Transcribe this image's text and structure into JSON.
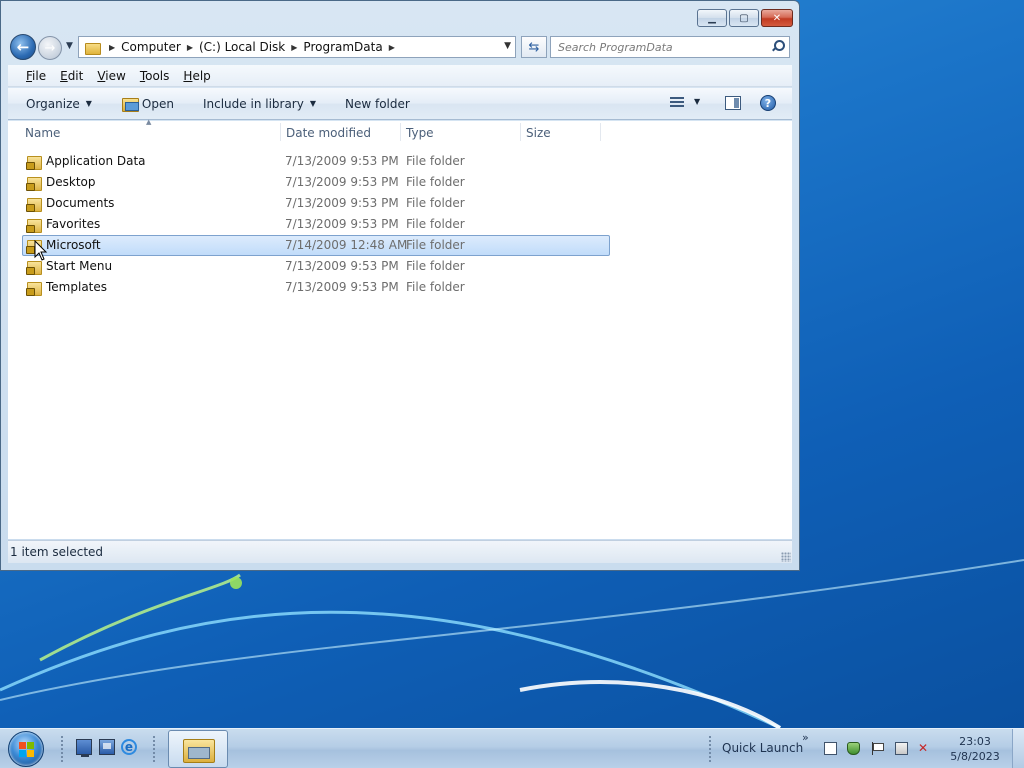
{
  "window": {
    "caption_buttons": [
      "minimize-icon",
      "maximize-icon",
      "close-icon"
    ]
  },
  "navigation": {
    "back_icon": "back-arrow-icon",
    "forward_icon": "forward-arrow-icon",
    "address_segments": [
      "Computer",
      "(C:) Local Disk",
      "ProgramData"
    ],
    "search_placeholder": "Search ProgramData"
  },
  "menu": [
    {
      "accel": "F",
      "rest": "ile"
    },
    {
      "accel": "E",
      "rest": "dit"
    },
    {
      "accel": "V",
      "rest": "iew"
    },
    {
      "accel": "T",
      "rest": "ools"
    },
    {
      "accel": "H",
      "rest": "elp"
    }
  ],
  "commands": {
    "organize": "Organize",
    "open": "Open",
    "include_in_library": "Include in library",
    "new_folder": "New folder"
  },
  "columns": {
    "name": "Name",
    "date_modified": "Date modified",
    "type": "Type",
    "size": "Size"
  },
  "files": [
    {
      "name": "Application Data",
      "date": "7/13/2009 9:53 PM",
      "type": "File folder",
      "size": "",
      "selected": false
    },
    {
      "name": "Desktop",
      "date": "7/13/2009 9:53 PM",
      "type": "File folder",
      "size": "",
      "selected": false
    },
    {
      "name": "Documents",
      "date": "7/13/2009 9:53 PM",
      "type": "File folder",
      "size": "",
      "selected": false
    },
    {
      "name": "Favorites",
      "date": "7/13/2009 9:53 PM",
      "type": "File folder",
      "size": "",
      "selected": false
    },
    {
      "name": "Microsoft",
      "date": "7/14/2009 12:48 AM",
      "type": "File folder",
      "size": "",
      "selected": true
    },
    {
      "name": "Start Menu",
      "date": "7/13/2009 9:53 PM",
      "type": "File folder",
      "size": "",
      "selected": false
    },
    {
      "name": "Templates",
      "date": "7/13/2009 9:53 PM",
      "type": "File folder",
      "size": "",
      "selected": false
    }
  ],
  "status": {
    "text": "1 item selected"
  },
  "taskbar": {
    "quick_launch_label": "Quick Launch",
    "chevrons": "»",
    "time": "23:03",
    "date": "5/8/2023"
  },
  "colors": {
    "selection": "#c1dcfa",
    "desktop": "#1b74c8"
  }
}
